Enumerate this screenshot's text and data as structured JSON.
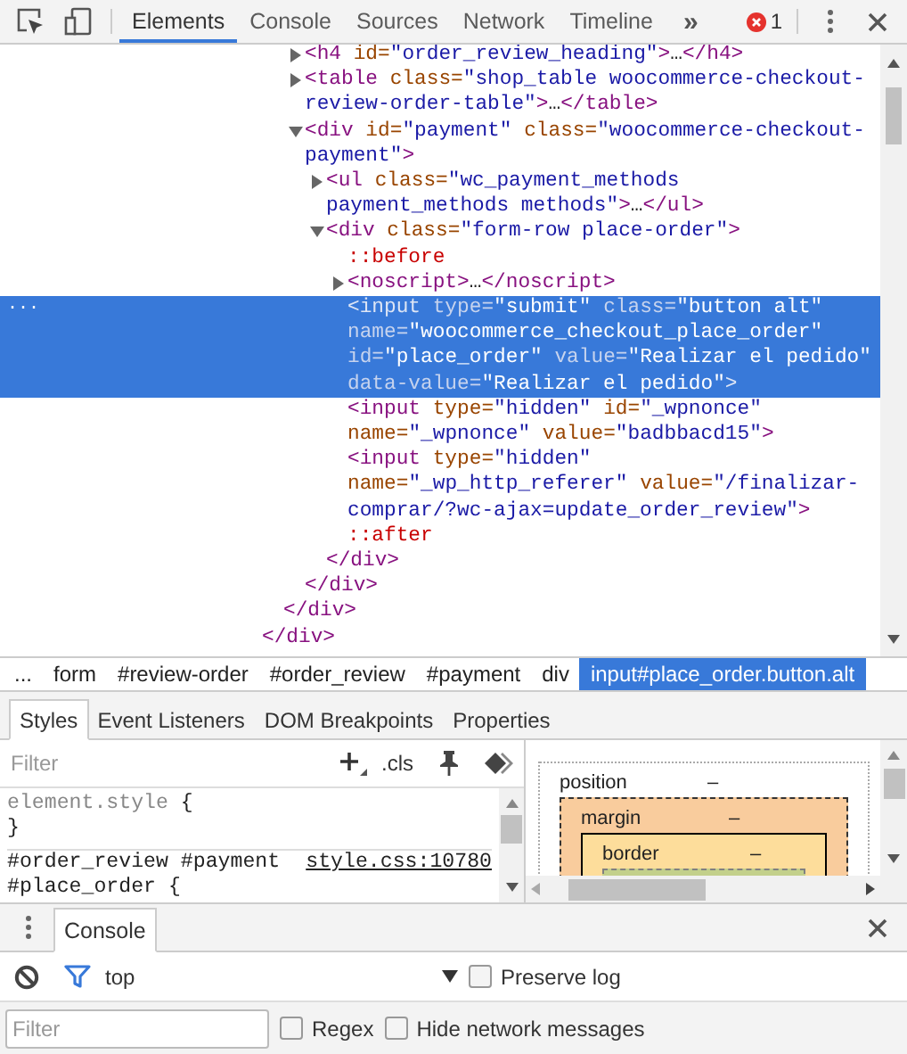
{
  "toolbar": {
    "tabs": [
      {
        "label": "Elements",
        "selected": true
      },
      {
        "label": "Console",
        "selected": false
      },
      {
        "label": "Sources",
        "selected": false
      },
      {
        "label": "Network",
        "selected": false
      },
      {
        "label": "Timeline",
        "selected": false
      }
    ],
    "overflow": "»",
    "error_count": "1"
  },
  "dom_tree": {
    "gutter_marker": "...",
    "nodes": [
      {
        "kind": "offscreen",
        "children": [
          {
            "kind": "offscreen",
            "children": [
              {
                "kind": "parent",
                "expanded": false,
                "selected": false,
                "tokens": [
                  {
                    "kind": "tag",
                    "text": "<h4"
                  },
                  {
                    "kind": "attr",
                    "text": " id"
                  },
                  {
                    "kind": "eq",
                    "text": "="
                  },
                  {
                    "kind": "val",
                    "text": "\"order_review_heading\""
                  },
                  {
                    "kind": "tag",
                    "text": ">"
                  },
                  {
                    "kind": "ell",
                    "text": "…"
                  },
                  {
                    "kind": "tag",
                    "text": "</h4>"
                  }
                ]
              },
              {
                "kind": "parent",
                "expanded": false,
                "selected": false,
                "tokens": [
                  {
                    "kind": "tag",
                    "text": "<table"
                  },
                  {
                    "kind": "attr",
                    "text": " class"
                  },
                  {
                    "kind": "eq",
                    "text": "="
                  },
                  {
                    "kind": "val",
                    "text": "\"shop_table woocommerce-checkout-review-order-table\""
                  },
                  {
                    "kind": "tag",
                    "text": ">"
                  },
                  {
                    "kind": "ell",
                    "text": "…"
                  },
                  {
                    "kind": "tag",
                    "text": "</table>"
                  }
                ]
              },
              {
                "kind": "parent",
                "expanded": true,
                "selected": false,
                "tokens": [
                  {
                    "kind": "tag",
                    "text": "<div"
                  },
                  {
                    "kind": "attr",
                    "text": " id"
                  },
                  {
                    "kind": "eq",
                    "text": "="
                  },
                  {
                    "kind": "val",
                    "text": "\"payment\""
                  },
                  {
                    "kind": "attr",
                    "text": " class"
                  },
                  {
                    "kind": "eq",
                    "text": "="
                  },
                  {
                    "kind": "val",
                    "text": "\"woocommerce-checkout-payment\""
                  },
                  {
                    "kind": "tag",
                    "text": ">"
                  }
                ],
                "children": [
                  {
                    "kind": "parent",
                    "expanded": false,
                    "selected": false,
                    "tokens": [
                      {
                        "kind": "tag",
                        "text": "<ul"
                      },
                      {
                        "kind": "attr",
                        "text": " class"
                      },
                      {
                        "kind": "eq",
                        "text": "="
                      },
                      {
                        "kind": "val",
                        "text": "\"wc_payment_methods payment_methods methods\""
                      },
                      {
                        "kind": "tag",
                        "text": ">"
                      },
                      {
                        "kind": "ell",
                        "text": "…"
                      },
                      {
                        "kind": "tag",
                        "text": "</ul>"
                      }
                    ]
                  },
                  {
                    "kind": "parent",
                    "expanded": true,
                    "selected": false,
                    "tokens": [
                      {
                        "kind": "tag",
                        "text": "<div"
                      },
                      {
                        "kind": "attr",
                        "text": " class"
                      },
                      {
                        "kind": "eq",
                        "text": "="
                      },
                      {
                        "kind": "val",
                        "text": "\"form-row place-order\""
                      },
                      {
                        "kind": "tag",
                        "text": ">"
                      }
                    ],
                    "children": [
                      {
                        "kind": "leaf",
                        "selected": false,
                        "tokens": [
                          {
                            "kind": "pseudo",
                            "text": "::before"
                          }
                        ]
                      },
                      {
                        "kind": "parent",
                        "expanded": false,
                        "selected": false,
                        "tokens": [
                          {
                            "kind": "tag",
                            "text": "<noscript>"
                          },
                          {
                            "kind": "ell",
                            "text": "…"
                          },
                          {
                            "kind": "tag",
                            "text": "</noscript>"
                          }
                        ]
                      },
                      {
                        "kind": "leaf",
                        "selected": true,
                        "tokens": [
                          {
                            "kind": "tag",
                            "text": "<input"
                          },
                          {
                            "kind": "attr",
                            "text": " type"
                          },
                          {
                            "kind": "eq",
                            "text": "="
                          },
                          {
                            "kind": "val",
                            "text": "\"submit\""
                          },
                          {
                            "kind": "attr",
                            "text": " class"
                          },
                          {
                            "kind": "eq",
                            "text": "="
                          },
                          {
                            "kind": "val",
                            "text": "\"button alt\""
                          },
                          {
                            "kind": "attr",
                            "text": " name"
                          },
                          {
                            "kind": "eq",
                            "text": "="
                          },
                          {
                            "kind": "val",
                            "text": "\"woocommerce_checkout_place_order\""
                          },
                          {
                            "kind": "attr",
                            "text": " id"
                          },
                          {
                            "kind": "eq",
                            "text": "="
                          },
                          {
                            "kind": "val",
                            "text": "\"place_order\""
                          },
                          {
                            "kind": "attr",
                            "text": " value"
                          },
                          {
                            "kind": "eq",
                            "text": "="
                          },
                          {
                            "kind": "val",
                            "text": "\"Realizar el pedido\""
                          },
                          {
                            "kind": "attr",
                            "text": " data-value"
                          },
                          {
                            "kind": "eq",
                            "text": "="
                          },
                          {
                            "kind": "val",
                            "text": "\"Realizar el pedido\""
                          },
                          {
                            "kind": "tag",
                            "text": ">"
                          }
                        ]
                      },
                      {
                        "kind": "leaf",
                        "selected": false,
                        "tokens": [
                          {
                            "kind": "tag",
                            "text": "<input"
                          },
                          {
                            "kind": "attr",
                            "text": " type"
                          },
                          {
                            "kind": "eq",
                            "text": "="
                          },
                          {
                            "kind": "val",
                            "text": "\"hidden\""
                          },
                          {
                            "kind": "attr",
                            "text": " id"
                          },
                          {
                            "kind": "eq",
                            "text": "="
                          },
                          {
                            "kind": "val",
                            "text": "\"_wpnonce\""
                          },
                          {
                            "kind": "attr",
                            "text": " name"
                          },
                          {
                            "kind": "eq",
                            "text": "="
                          },
                          {
                            "kind": "val",
                            "text": "\"_wpnonce\""
                          },
                          {
                            "kind": "attr",
                            "text": " value"
                          },
                          {
                            "kind": "eq",
                            "text": "="
                          },
                          {
                            "kind": "val",
                            "text": "\"badbbacd15\""
                          },
                          {
                            "kind": "tag",
                            "text": ">"
                          }
                        ]
                      },
                      {
                        "kind": "leaf",
                        "selected": false,
                        "tokens": [
                          {
                            "kind": "tag",
                            "text": "<input"
                          },
                          {
                            "kind": "attr",
                            "text": " type"
                          },
                          {
                            "kind": "eq",
                            "text": "="
                          },
                          {
                            "kind": "val",
                            "text": "\"hidden\""
                          },
                          {
                            "kind": "attr",
                            "text": " name"
                          },
                          {
                            "kind": "eq",
                            "text": "="
                          },
                          {
                            "kind": "val",
                            "text": "\"_wp_http_referer\""
                          },
                          {
                            "kind": "attr",
                            "text": " value"
                          },
                          {
                            "kind": "eq",
                            "text": "="
                          },
                          {
                            "kind": "val",
                            "text": "\"/finalizar-comprar/?wc-ajax=update_order_review\""
                          },
                          {
                            "kind": "tag",
                            "text": ">"
                          }
                        ]
                      },
                      {
                        "kind": "leaf",
                        "selected": false,
                        "tokens": [
                          {
                            "kind": "pseudo",
                            "text": "::after"
                          }
                        ]
                      }
                    ],
                    "closing": "</div>"
                  }
                ],
                "closing": "</div>"
              }
            ],
            "closing": "</div>"
          }
        ],
        "closing": "</div>"
      }
    ]
  },
  "breadcrumbs": [
    {
      "label": "...",
      "selected": false
    },
    {
      "label": "form",
      "selected": false
    },
    {
      "label": "#review-order",
      "selected": false
    },
    {
      "label": "#order_review",
      "selected": false
    },
    {
      "label": "#payment",
      "selected": false
    },
    {
      "label": "div",
      "selected": false
    },
    {
      "label": "input#place_order.button.alt",
      "selected": true
    }
  ],
  "styles": {
    "tabs": [
      {
        "label": "Styles",
        "selected": true
      },
      {
        "label": "Event Listeners",
        "selected": false
      },
      {
        "label": "DOM Breakpoints",
        "selected": false
      },
      {
        "label": "Properties",
        "selected": false
      }
    ],
    "filter": {
      "placeholder": "Filter"
    },
    "cls": ".cls",
    "rules": [
      {
        "kind": "inline",
        "selector": "element.style",
        "open": " {",
        "close": "}"
      },
      {
        "kind": "matched",
        "selector": "#order_review #payment",
        "source": "style.css:10780",
        "selector_more": "#place_order {"
      }
    ],
    "box_model": [
      {
        "kind": "position",
        "label": "position",
        "value": "–"
      },
      {
        "kind": "margin",
        "label": "margin",
        "value": "–"
      },
      {
        "kind": "border",
        "label": "border",
        "value": "–"
      },
      {
        "kind": "padding"
      }
    ]
  },
  "console_drawer": {
    "tabs": [
      {
        "label": "Console",
        "selected": true
      }
    ],
    "context": "top",
    "preserve_log": {
      "label": "Preserve log",
      "checked": false
    },
    "filter": {
      "placeholder": "Filter"
    },
    "regex": {
      "label": "Regex",
      "checked": false
    },
    "hide_network": {
      "label": "Hide network messages",
      "checked": false
    }
  }
}
